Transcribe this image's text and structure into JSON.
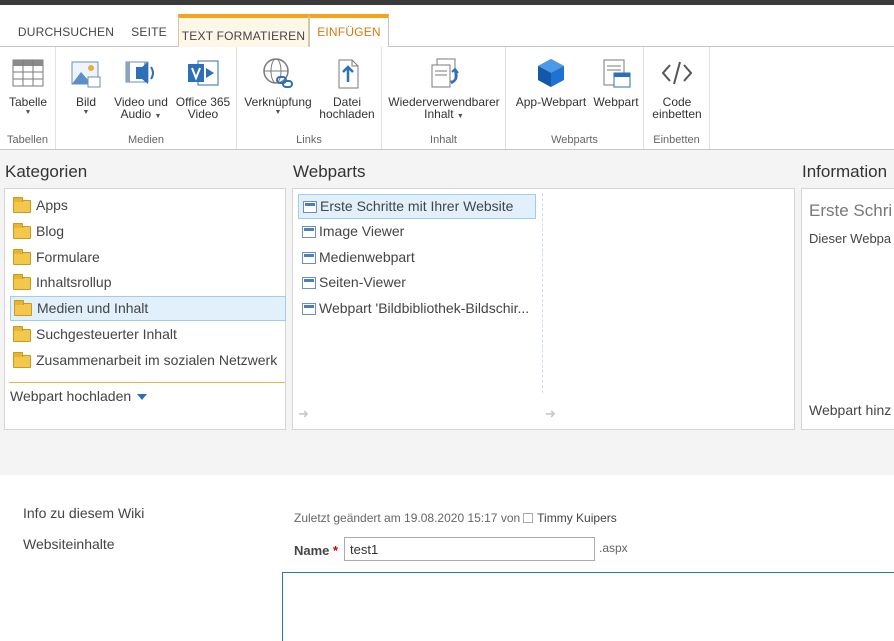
{
  "tabs": [
    {
      "label": "DURCHSUCHEN"
    },
    {
      "label": "SEITE"
    },
    {
      "label": "TEXT FORMATIEREN"
    },
    {
      "label": "EINFÜGEN"
    }
  ],
  "ribbon": {
    "groups": {
      "tabellen": "Tabellen",
      "medien": "Medien",
      "links": "Links",
      "inhalt": "Inhalt",
      "webparts": "Webparts",
      "einbetten": "Einbetten"
    },
    "buttons": {
      "tabelle": "Tabelle",
      "bild": "Bild",
      "video_1": "Video und",
      "video_2": "Audio",
      "office_1": "Office 365",
      "office_2": "Video",
      "verknuepfung": "Verknüpfung",
      "datei_1": "Datei",
      "datei_2": "hochladen",
      "wieder_1": "Wiederverwendbarer",
      "wieder_2": "Inhalt",
      "appwebpart": "App-Webpart",
      "webpart": "Webpart",
      "code_1": "Code",
      "code_2": "einbetten"
    },
    "colors": {
      "accent": "#f5a31a",
      "icon_blue": "#2d6fb9"
    }
  },
  "panels": {
    "categories_title": "Kategorien",
    "webparts_title": "Webparts",
    "info_title": "Information",
    "categories": [
      {
        "label": "Apps"
      },
      {
        "label": "Blog"
      },
      {
        "label": "Formulare"
      },
      {
        "label": "Inhaltsrollup"
      },
      {
        "label": "Medien und Inhalt"
      },
      {
        "label": "Suchgesteuerter Inhalt"
      },
      {
        "label": "Zusammenarbeit im sozialen Netzwerk"
      }
    ],
    "selected_category": "Medien und Inhalt",
    "upload_label": "Webpart hochladen",
    "webparts": [
      {
        "label": "Erste Schritte mit Ihrer Website"
      },
      {
        "label": "Image Viewer"
      },
      {
        "label": "Medienwebpart"
      },
      {
        "label": "Seiten-Viewer"
      },
      {
        "label": "Webpart 'Bildbibliothek-Bildschir..."
      }
    ],
    "info_heading": "Erste Schri",
    "info_desc": "Dieser Webpa",
    "info_footer": "Webpart hinz"
  },
  "nav": {
    "items": [
      "Info zu diesem Wiki",
      "Websiteinhalte"
    ]
  },
  "page": {
    "meta_prefix": "Zuletzt geändert am 19.08.2020 15:17 von",
    "user": "Timmy Kuipers",
    "name_label": "Name",
    "name_required": "*",
    "name_value": "test1",
    "ext": ".aspx"
  }
}
